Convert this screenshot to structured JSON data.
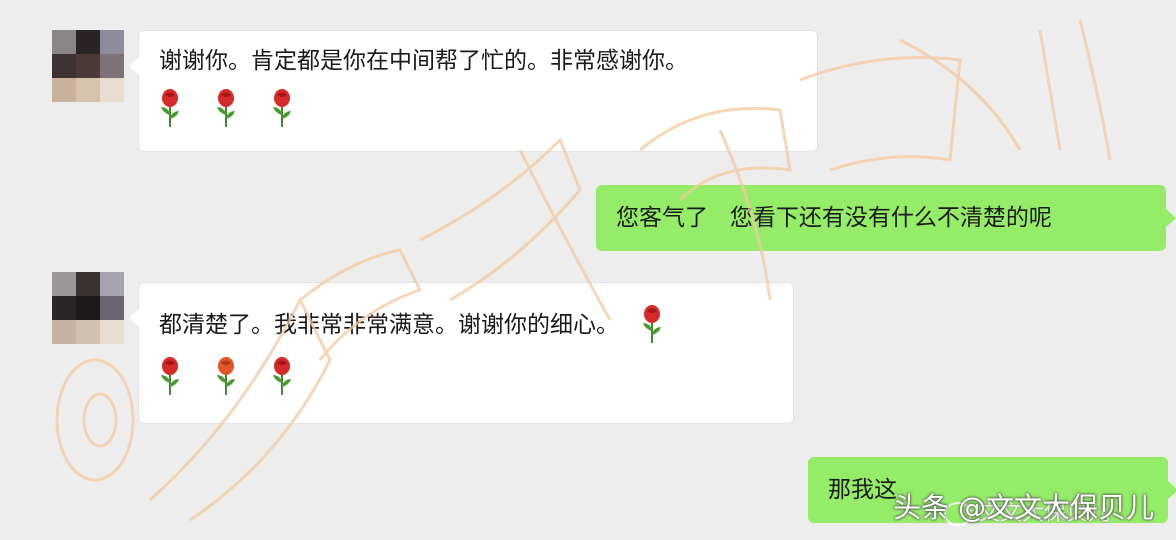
{
  "chat": {
    "messages": [
      {
        "side": "in",
        "text": "谢谢你。肯定都是你在中间帮了忙的。非常感谢你。",
        "emoji": [
          "rose",
          "rose",
          "rose"
        ]
      },
      {
        "side": "out",
        "text": "您客气了   您看下还有没有什么不清楚的呢"
      },
      {
        "side": "in",
        "text": "都清楚了。我非常非常满意。谢谢你的细心。",
        "emoji_inline": "rose",
        "emoji": [
          "rose",
          "rose",
          "rose"
        ]
      },
      {
        "side": "out",
        "text": "那我这"
      }
    ]
  },
  "watermark": {
    "stamp": "@文文大保贝儿",
    "wechat_label": "文文大保贝儿",
    "footer": "头条 @文文大保贝儿"
  },
  "colors": {
    "background": "#ededed",
    "incoming_bubble": "#ffffff",
    "outgoing_bubble": "#95ec69",
    "watermark": "#f3c9a0"
  }
}
